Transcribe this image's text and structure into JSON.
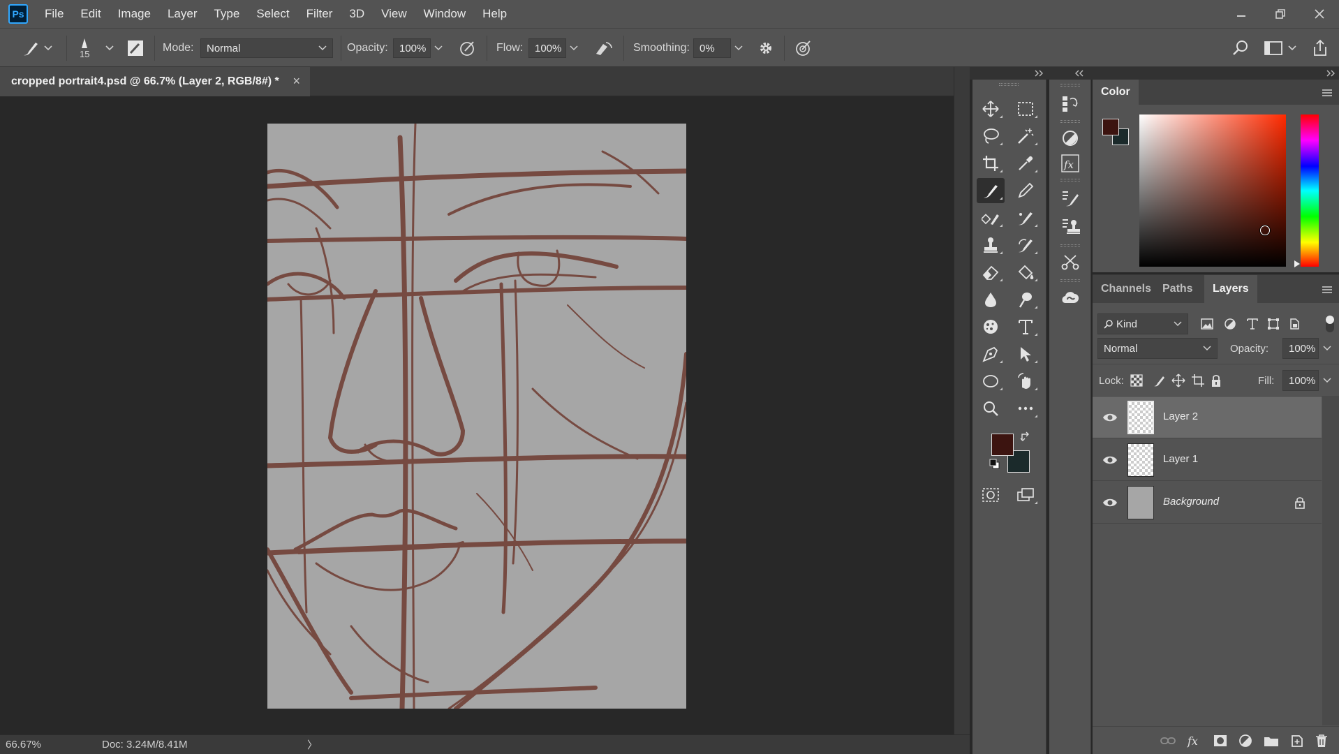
{
  "app": {
    "logo": "Ps"
  },
  "menu": [
    "File",
    "Edit",
    "Image",
    "Layer",
    "Type",
    "Select",
    "Filter",
    "3D",
    "View",
    "Window",
    "Help"
  ],
  "options": {
    "brush_size": "15",
    "mode_label": "Mode:",
    "mode_value": "Normal",
    "opacity_label": "Opacity:",
    "opacity_value": "100%",
    "flow_label": "Flow:",
    "flow_value": "100%",
    "smoothing_label": "Smoothing:",
    "smoothing_value": "0%"
  },
  "document": {
    "tab_title": "cropped portrait4.psd @ 66.7% (Layer 2, RGB/8#) *",
    "close_glyph": "×"
  },
  "status": {
    "zoom": "66.67%",
    "doc_info": "Doc: 3.24M/8.41M",
    "arrow": "〉"
  },
  "color_panel": {
    "tab": "Color",
    "foreground": "#3c1410",
    "background": "#1b2a2b"
  },
  "layers_panel": {
    "tabs": [
      "Channels",
      "Paths",
      "Layers"
    ],
    "kind_label": "Kind",
    "blend_mode": "Normal",
    "opacity_label": "Opacity:",
    "opacity_value": "100%",
    "lock_label": "Lock:",
    "fill_label": "Fill:",
    "fill_value": "100%",
    "layers": [
      {
        "name": "Layer 2",
        "selected": true,
        "locked": false
      },
      {
        "name": "Layer 1",
        "selected": false,
        "locked": false
      },
      {
        "name": "Background",
        "selected": false,
        "locked": true
      }
    ]
  },
  "toolbar_colors": {
    "foreground": "#3c1410",
    "background": "#1b2a2b"
  },
  "sketch_color": "#6e3a30"
}
